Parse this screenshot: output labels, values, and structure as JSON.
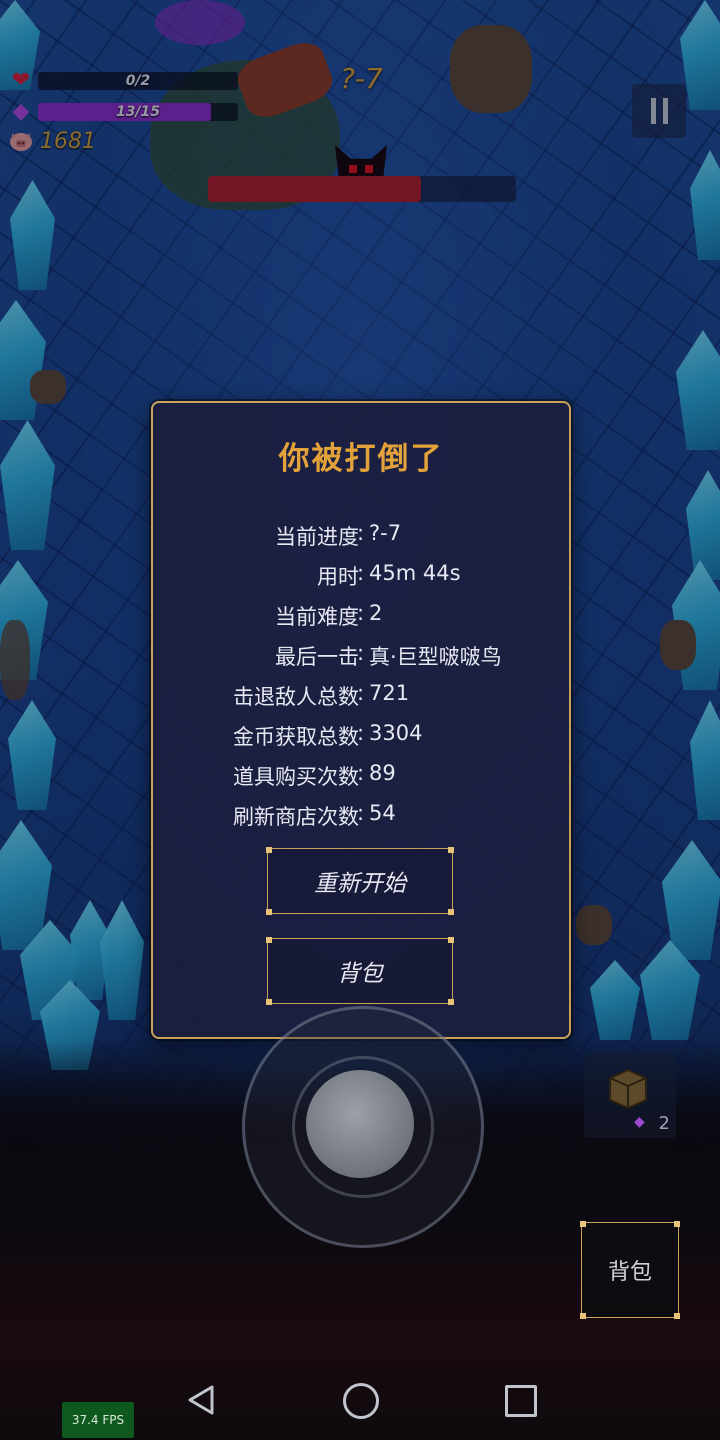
{
  "hud": {
    "health_text": "0/2",
    "health_fraction": 0.0,
    "mana_text": "13/15",
    "mana_fraction": 0.867,
    "coins": "1681",
    "stage": "?-7",
    "boss_health_fraction": 0.69,
    "colors": {
      "health": "#c0162a",
      "mana": "#8a2cc8",
      "coin_text": "#d2a13a"
    }
  },
  "dialog": {
    "title": "你被打倒了",
    "stats": [
      {
        "label": "当前进度",
        "value": "?-7"
      },
      {
        "label": "用时",
        "value": "45m 44s"
      },
      {
        "label": "当前难度",
        "value": "2"
      },
      {
        "label": "最后一击",
        "value": "真·巨型啵啵鸟"
      },
      {
        "label": "击退敌人总数",
        "value": "721"
      },
      {
        "label": "金币获取总数",
        "value": "3304"
      },
      {
        "label": "道具购买次数",
        "value": "89"
      },
      {
        "label": "刷新商店次数",
        "value": "54"
      }
    ],
    "restart_label": "重新开始",
    "backpack_label": "背包"
  },
  "controls": {
    "item_slot_count": "2",
    "bag_label": "背包"
  },
  "system": {
    "fps": "37.4 FPS"
  },
  "icons": {
    "health": "heart-icon",
    "mana": "gem-icon",
    "coins": "pig-icon",
    "pause": "pause-icon",
    "back": "nav-back-icon",
    "home": "nav-home-icon",
    "recent": "nav-recent-icon"
  }
}
